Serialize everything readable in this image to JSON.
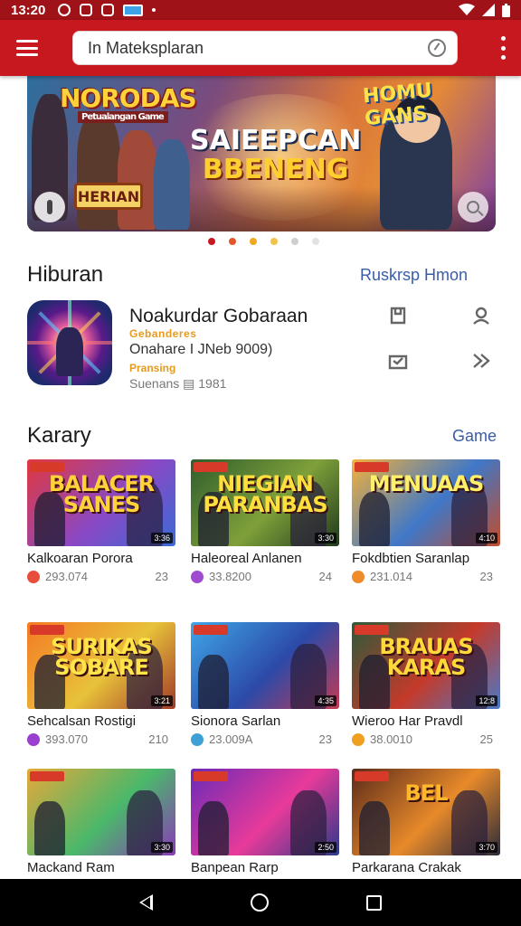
{
  "status_bar": {
    "time": "13:20"
  },
  "app_bar": {
    "search_value": "In Mateksplaran"
  },
  "banner": {
    "logo_left": "NORODAS",
    "logo_left_sub": "Petualangan Game",
    "logo_right": "HOMU GANS",
    "title_line1": "SAIEEPCAN",
    "title_line2": "BBENENG",
    "sign_text": "HERIAN"
  },
  "carousel": {
    "active_index": 0,
    "dot_colors": [
      "#c8181f",
      "#e4552a",
      "#f0a81e",
      "#f3c24a",
      "#cfcfcf",
      "#e3e3e3"
    ]
  },
  "sections": {
    "hiburan": {
      "title": "Hiburan",
      "link": "Ruskrsp Hmon"
    },
    "karary": {
      "title": "Karary",
      "link": "Game"
    }
  },
  "featured": {
    "title": "Noakurdar Gobaraan",
    "tag1": "Gebanderes",
    "subtitle": "Onahare I JNeb 9009)",
    "tag2": "Pransing",
    "meta": "Suenans  ▤ 1981"
  },
  "cards": [
    {
      "title": "Kalkoaran Porora",
      "views": "293.074",
      "rating": "23",
      "logo": "BALACER SANES",
      "duration": "3:36",
      "icon_color": "#e84e3c",
      "colors": [
        "#e2383e",
        "#8a48c4",
        "#3a6bd6"
      ],
      "logo_color": "#ffd23a"
    },
    {
      "title": "Haleoreal Anlanen",
      "views": "33.8200",
      "rating": "24",
      "logo": "NIEGIAN PARANBAS",
      "duration": "3:30",
      "icon_color": "#a04bd0",
      "colors": [
        "#2f5d2c",
        "#7fa03a",
        "#1f3a1c"
      ],
      "logo_color": "#ffdf3e"
    },
    {
      "title": "Fokdbtien Saranlap",
      "views": "231.014",
      "rating": "23",
      "logo": "MENUAAS",
      "duration": "4:10",
      "icon_color": "#f08a2a",
      "colors": [
        "#f4b23a",
        "#3f78c8",
        "#c24c2a"
      ],
      "logo_color": "#fff06a"
    },
    {
      "title": "Sehcalsan Rostigi",
      "views": "393.070",
      "rating": "210",
      "logo": "SURIKAS SOBARE",
      "duration": "3:21",
      "icon_color": "#9a3fd0",
      "colors": [
        "#f47a24",
        "#e8c23a",
        "#a03a2a"
      ],
      "logo_color": "#ffe44a"
    },
    {
      "title": "Sionora Sarlan",
      "views": "23.009A",
      "rating": "23",
      "logo": "",
      "duration": "4:35",
      "icon_color": "#3fa0d6",
      "colors": [
        "#3fa6e8",
        "#2c4aa8",
        "#c43a54"
      ],
      "logo_color": "#ffd23a"
    },
    {
      "title": "Wieroo Har Pravdl",
      "views": "38.0010",
      "rating": "25",
      "logo": "BRAUAS KARAS",
      "duration": "12:8",
      "icon_color": "#f0a020",
      "colors": [
        "#2c5a3a",
        "#c43a2a",
        "#4a7ac8"
      ],
      "logo_color": "#ffd93a"
    },
    {
      "title": "Mackand Ram",
      "views": "",
      "rating": "",
      "logo": "",
      "duration": "3:30",
      "icon_color": "#e8a020",
      "colors": [
        "#e6a83a",
        "#4ab86a",
        "#8a3ab8"
      ],
      "logo_color": "#ffe14a"
    },
    {
      "title": "Banpean Rarp",
      "views": "",
      "rating": "",
      "logo": "",
      "duration": "2:50",
      "icon_color": "#9a3fd0",
      "colors": [
        "#6a2ab8",
        "#e83a9a",
        "#2a3a8a"
      ],
      "logo_color": "#ffd23a"
    },
    {
      "title": "Parkarana Crakak",
      "views": "",
      "rating": "",
      "logo": "BEL",
      "duration": "3:70",
      "icon_color": "#e84e3c",
      "colors": [
        "#5a2a1a",
        "#e88a2a",
        "#2a2a3a"
      ],
      "logo_color": "#ffb82a"
    }
  ]
}
